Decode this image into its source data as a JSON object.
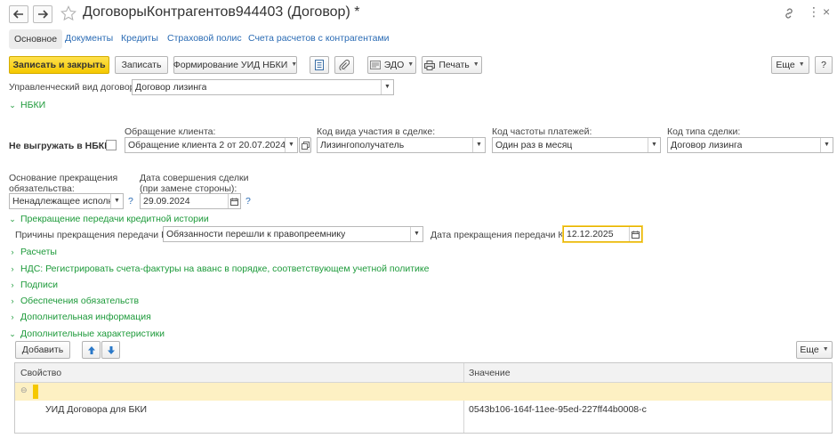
{
  "window": {
    "title": "ДоговорыКонтрагентов944403 (Договор) *"
  },
  "tabs": [
    {
      "label": "Основное"
    },
    {
      "label": "Документы"
    },
    {
      "label": "Кредиты"
    },
    {
      "label": "Страховой полис"
    },
    {
      "label": "Счета расчетов с контрагентами"
    }
  ],
  "toolbar": {
    "save_close": "Записать и закрыть",
    "save": "Записать",
    "form_uid": "Формирование УИД НБКИ",
    "edo": "ЭДО",
    "print": "Печать",
    "more": "Еще",
    "help": "?"
  },
  "contract_kind": {
    "label": "Управленческий вид договора:",
    "value": "Договор лизинга"
  },
  "nbki": {
    "header": "НБКИ",
    "no_export_label": "Не выгружать в НБКИ:",
    "client_request": {
      "label": "Обращение клиента:",
      "value": "Обращение клиента 2 от 20.07.2024 0:00:00"
    },
    "participation_code": {
      "label": "Код вида участия в сделке:",
      "value": "Лизингополучатель"
    },
    "payment_freq_code": {
      "label": "Код частоты платежей:",
      "value": "Один раз в месяц"
    },
    "deal_type_code": {
      "label": "Код типа сделки:",
      "value": "Договор лизинга"
    },
    "termination_basis": {
      "label": "Основание прекращения обязательства:",
      "value": "Ненадлежащее исполнение"
    },
    "deal_date": {
      "label": "Дата совершения сделки (при замене стороны):",
      "value": "29.09.2024"
    },
    "help_mark": "?"
  },
  "transfer_stop": {
    "header": "Прекращение передачи кредитной истории",
    "reason_label": "Причины прекращения передачи КИ:",
    "reason_value": "Обязанности перешли к правопреемнику",
    "date_label": "Дата прекращения передачи КИ:",
    "date_value": "12.12.2025"
  },
  "sections": [
    {
      "label": "Расчеты"
    },
    {
      "label": "НДС: Регистрировать счета-фактуры на аванс в порядке, соответствующем учетной политике"
    },
    {
      "label": "Подписи"
    },
    {
      "label": "Обеспечения обязательств"
    },
    {
      "label": "Дополнительная информация"
    }
  ],
  "extra": {
    "header": "Дополнительные характеристики",
    "add": "Добавить",
    "more": "Еще",
    "columns": {
      "property": "Свойство",
      "value": "Значение"
    },
    "rows": [
      {
        "property": "УИД Договора для БКИ",
        "value": "0543b106-164f-11ee-95ed-227ff44b0008-c"
      }
    ]
  },
  "colors": {
    "accent_yellow": "#f5c800",
    "section_green": "#1d9a3a",
    "link_blue": "#2a6bb4",
    "group_row": "#fdf0c3"
  }
}
